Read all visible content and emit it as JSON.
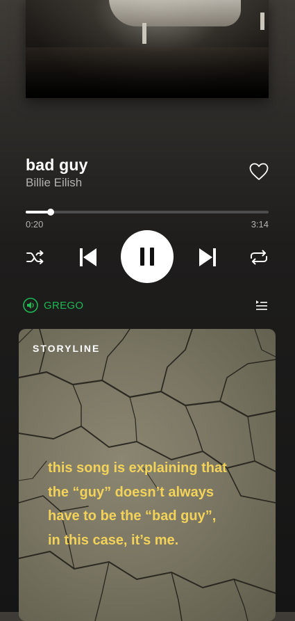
{
  "player": {
    "track_title": "bad guy",
    "artist": "Billie Eilish",
    "liked": false,
    "progress": {
      "elapsed": "0:20",
      "total": "3:14",
      "fraction": 0.103
    },
    "state": "playing",
    "shuffle": false,
    "repeat": false
  },
  "device": {
    "name": "GREGO",
    "icon": "speaker-icon",
    "color": "#1db954"
  },
  "storyline": {
    "label": "STORYLINE",
    "lines": [
      "this song is explaining that",
      "the “guy” doesn’t always",
      "have to be the “bad guy”,",
      "in this case, it’s me."
    ],
    "text_color": "#f3d25a"
  },
  "icons": {
    "like": "heart-icon",
    "shuffle": "shuffle-icon",
    "previous": "skip-previous-icon",
    "pause": "pause-icon",
    "next": "skip-next-icon",
    "repeat": "repeat-icon",
    "queue": "queue-icon"
  }
}
